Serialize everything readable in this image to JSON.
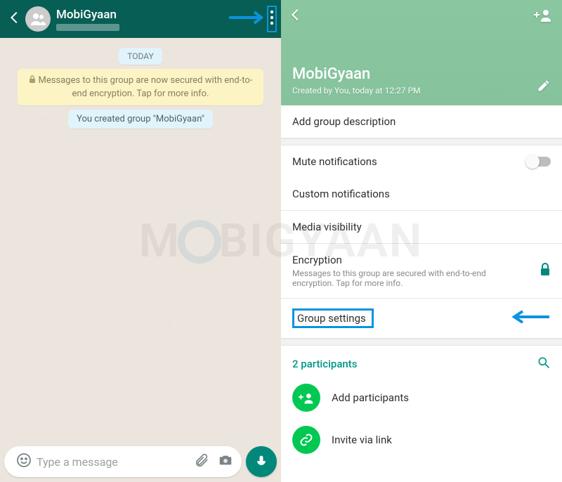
{
  "left": {
    "group_name": "MobiGyaan",
    "date_chip": "TODAY",
    "encryption_notice": "Messages to this group are now secured with end-to-end encryption. Tap for more info.",
    "system_message": "You created group \"MobiGyaan\"",
    "input_placeholder": "Type a message"
  },
  "right": {
    "group_name": "MobiGyaan",
    "created_sub": "Created by You, today at 12:27 PM",
    "add_description": "Add group description",
    "mute": "Mute notifications",
    "custom": "Custom notifications",
    "media": "Media visibility",
    "encryption_title": "Encryption",
    "encryption_sub": "Messages to this group are secured with end-to-end encryption. Tap for more info.",
    "group_settings": "Group settings",
    "participants_count": "2 participants",
    "add_participants": "Add participants",
    "invite_link": "Invite via link"
  },
  "watermark_left": "M",
  "watermark_right": "BIGYAAN"
}
